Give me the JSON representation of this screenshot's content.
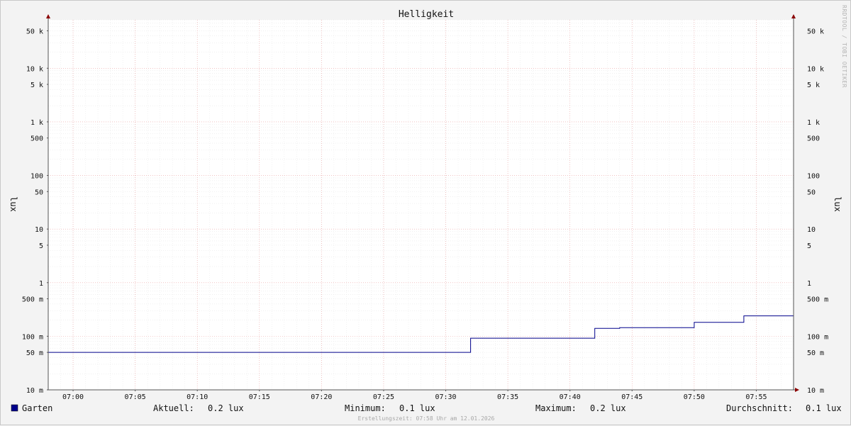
{
  "chart_data": {
    "type": "line",
    "title": "Helligkeit",
    "ylabel": "lux",
    "yscale": "log",
    "ylim": [
      10,
      80000
    ],
    "xlim": [
      "06:58",
      "07:58"
    ],
    "x_ticks": [
      "07:00",
      "07:05",
      "07:10",
      "07:15",
      "07:20",
      "07:25",
      "07:30",
      "07:35",
      "07:40",
      "07:45",
      "07:50",
      "07:55"
    ],
    "y_ticks": [
      {
        "value": 50000,
        "label": "50 k"
      },
      {
        "value": 10000,
        "label": "10 k"
      },
      {
        "value": 5000,
        "label": "5 k"
      },
      {
        "value": 1000,
        "label": "1 k"
      },
      {
        "value": 500,
        "label": "500"
      },
      {
        "value": 100,
        "label": "100"
      },
      {
        "value": 50,
        "label": "50"
      },
      {
        "value": 10,
        "label": "10"
      },
      {
        "value": 5,
        "label": "5"
      },
      {
        "value": 1,
        "label": "1"
      },
      {
        "value": 0.5,
        "label": "500 m"
      },
      {
        "value": 0.1,
        "label": "100 m"
      },
      {
        "value": 0.05,
        "label": "50 m"
      },
      {
        "value": 0.01,
        "label": "10 m"
      }
    ],
    "series": [
      {
        "name": "Garten",
        "color": "#00008b",
        "step": true,
        "points": [
          [
            "06:58",
            0.05
          ],
          [
            "07:32",
            0.05
          ],
          [
            "07:32",
            0.092
          ],
          [
            "07:42",
            0.092
          ],
          [
            "07:42",
            0.14
          ],
          [
            "07:44",
            0.14
          ],
          [
            "07:44",
            0.145
          ],
          [
            "07:50",
            0.145
          ],
          [
            "07:50",
            0.182
          ],
          [
            "07:54",
            0.182
          ],
          [
            "07:54",
            0.24
          ],
          [
            "07:58",
            0.24
          ]
        ]
      }
    ],
    "grid": true
  },
  "legend": {
    "series_name": "Garten",
    "swatch_color": "#00008b",
    "current_label": "Aktuell:",
    "current_value": "0.2 lux",
    "min_label": "Minimum:",
    "min_value": "0.1 lux",
    "max_label": "Maximum:",
    "max_value": "0.2 lux",
    "avg_label": "Durchschnitt:",
    "avg_value": "0.1 lux"
  },
  "footer": "Erstellungszeit: 07:58 Uhr am 12.01.2026",
  "watermark": "RRDTOOL / TOBI OETIKER"
}
